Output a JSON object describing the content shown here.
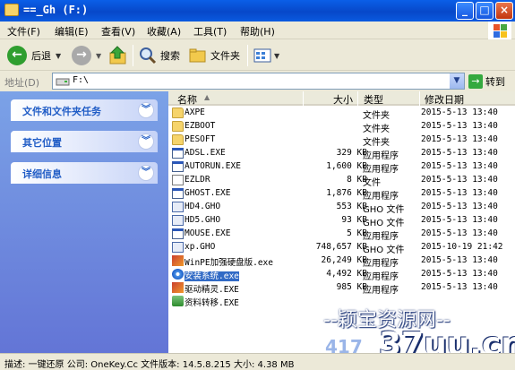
{
  "window": {
    "title": "_Gh (F:)"
  },
  "menu": [
    "文件(F)",
    "编辑(E)",
    "查看(V)",
    "收藏(A)",
    "工具(T)",
    "帮助(H)"
  ],
  "toolbar": {
    "back_label": "后退",
    "search_label": "搜索",
    "folders_label": "文件夹"
  },
  "address": {
    "label": "地址(D)",
    "value": "F:\\",
    "go_label": "转到"
  },
  "tasks": [
    {
      "label": "文件和文件夹任务"
    },
    {
      "label": "其它位置"
    },
    {
      "label": "详细信息"
    }
  ],
  "columns": {
    "name": "名称",
    "size": "大小",
    "type": "类型",
    "modified": "修改日期"
  },
  "files": [
    {
      "name": "AXPE",
      "size": "",
      "type": "文件夹",
      "modified": "2015-5-13 13:40",
      "icon": "folder-icon"
    },
    {
      "name": "EZBOOT",
      "size": "",
      "type": "文件夹",
      "modified": "2015-5-13 13:40",
      "icon": "folder-icon"
    },
    {
      "name": "PESOFT",
      "size": "",
      "type": "文件夹",
      "modified": "2015-5-13 13:40",
      "icon": "folder-icon"
    },
    {
      "name": "ADSL.EXE",
      "size": "329 KB",
      "type": "应用程序",
      "modified": "2015-5-13 13:40",
      "icon": "exe-icon"
    },
    {
      "name": "AUTORUN.EXE",
      "size": "1,600 KB",
      "type": "应用程序",
      "modified": "2015-5-13 13:40",
      "icon": "exe-icon"
    },
    {
      "name": "EZLDR",
      "size": "8 KB",
      "type": "文件",
      "modified": "2015-5-13 13:40",
      "icon": "file-icon"
    },
    {
      "name": "GHOST.EXE",
      "size": "1,876 KB",
      "type": "应用程序",
      "modified": "2015-5-13 13:40",
      "icon": "exe-icon"
    },
    {
      "name": "HD4.GHO",
      "size": "553 KB",
      "type": "GHO 文件",
      "modified": "2015-5-13 13:40",
      "icon": "gho-icon"
    },
    {
      "name": "HD5.GHO",
      "size": "93 KB",
      "type": "GHO 文件",
      "modified": "2015-5-13 13:40",
      "icon": "gho-icon"
    },
    {
      "name": "MOUSE.EXE",
      "size": "5 KB",
      "type": "应用程序",
      "modified": "2015-5-13 13:40",
      "icon": "exe-icon"
    },
    {
      "name": "xp.GHO",
      "size": "748,657 KB",
      "type": "GHO 文件",
      "modified": "2015-10-19 21:42",
      "icon": "gho-icon"
    },
    {
      "name": "WinPE加强硬盘版.exe",
      "size": "26,249 KB",
      "type": "应用程序",
      "modified": "2015-5-13 13:40",
      "icon": "tool-icon"
    },
    {
      "name": "安装系统.exe",
      "size": "4,492 KB",
      "type": "应用程序",
      "modified": "2015-5-13 13:40",
      "icon": "disk-icon"
    },
    {
      "name": "驱动精灵.EXE",
      "size": "985 KB",
      "type": "应用程序",
      "modified": "2015-5-13 13:40",
      "icon": "tool-icon"
    },
    {
      "name": "资料转移.EXE",
      "size": "",
      "type": "",
      "modified": "",
      "icon": "green-icon"
    }
  ],
  "status": {
    "text": "描述: 一键还原 公司: OneKey.Cc 文件版本: 14.5.8.215 大小: 4.38 MB"
  },
  "watermark": {
    "site_name": "--颖宝资源网--",
    "number": "417",
    "domain": "37uu.cn"
  }
}
